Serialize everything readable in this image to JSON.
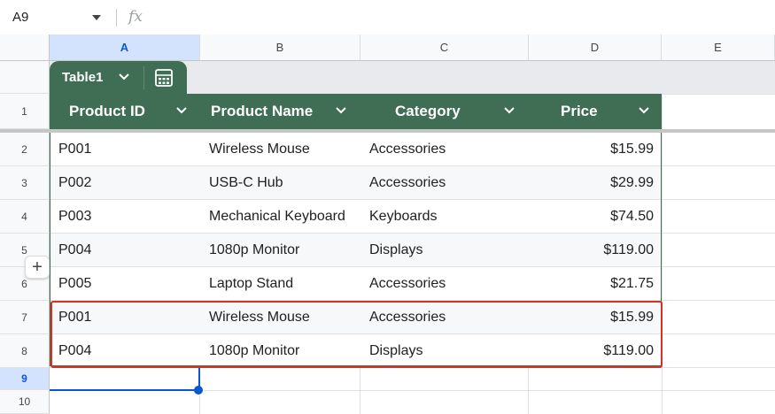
{
  "formula_bar": {
    "name_box": "A9",
    "fx_label": "fx"
  },
  "columns": [
    "A",
    "B",
    "C",
    "D",
    "E"
  ],
  "rows": [
    "1",
    "2",
    "3",
    "4",
    "5",
    "6",
    "7",
    "8",
    "9",
    "10"
  ],
  "table": {
    "name": "Table1",
    "headers": [
      "Product ID",
      "Product Name",
      "Category",
      "Price"
    ],
    "rows": [
      [
        "P001",
        "Wireless Mouse",
        "Accessories",
        "$15.99"
      ],
      [
        "P002",
        "USB-C Hub",
        "Accessories",
        "$29.99"
      ],
      [
        "P003",
        "Mechanical Keyboard",
        "Keyboards",
        "$74.50"
      ],
      [
        "P004",
        "1080p Monitor",
        "Displays",
        "$119.00"
      ],
      [
        "P005",
        "Laptop Stand",
        "Accessories",
        "$21.75"
      ],
      [
        "P001",
        "Wireless Mouse",
        "Accessories",
        "$15.99"
      ],
      [
        "P004",
        "1080p Monitor",
        "Displays",
        "$119.00"
      ]
    ]
  },
  "add_row_label": "+",
  "colors": {
    "table_green": "#3f6e55",
    "highlight_red": "#d93025",
    "selection_blue": "#0b57d0"
  }
}
